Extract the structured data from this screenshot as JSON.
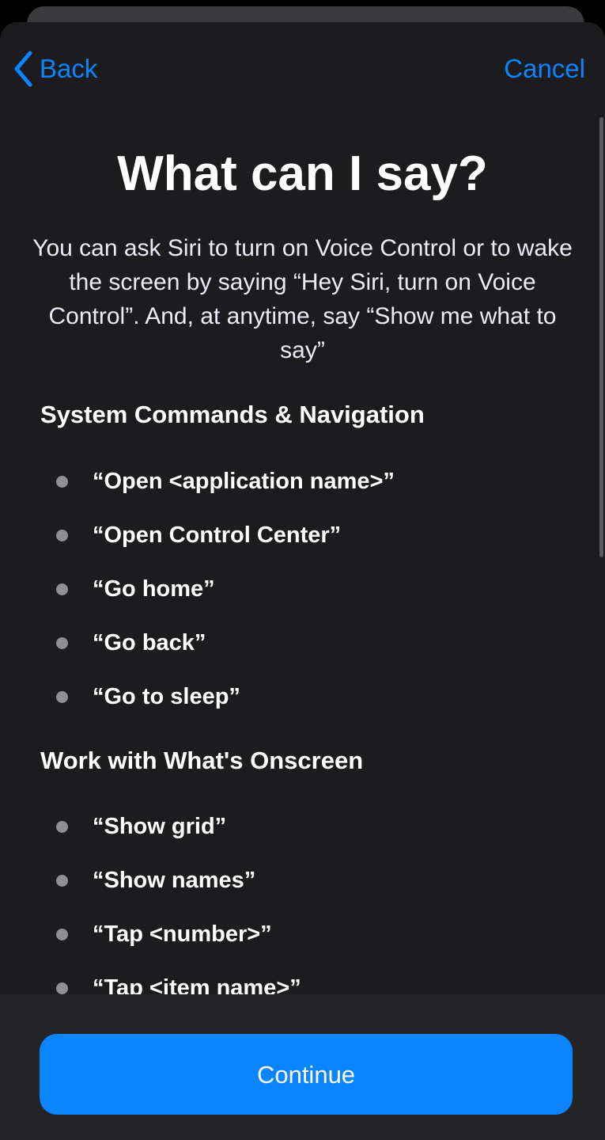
{
  "nav": {
    "back_label": "Back",
    "cancel_label": "Cancel"
  },
  "content": {
    "title": "What can I say?",
    "description": "You can ask Siri to turn on Voice Control or to wake the screen by saying “Hey Siri, turn on Voice Control”. And, at anytime, say “Show me what to say”",
    "sections": [
      {
        "title": "System Commands & Navigation",
        "items": [
          "“Open <application name>”",
          "“Open Control Center”",
          "“Go home”",
          "“Go back”",
          "“Go to sleep”"
        ]
      },
      {
        "title": "Work with What's Onscreen",
        "items": [
          "“Show grid”",
          "“Show names”",
          "“Tap <number>”",
          "“Tap <item name>”"
        ]
      }
    ]
  },
  "footer": {
    "continue_label": "Continue"
  },
  "colors": {
    "accent": "#0a84ff",
    "sheet_background": "#1c1c1e",
    "footer_background": "#242426",
    "bullet": "#8e8e93"
  },
  "icons": {
    "back": "chevron-left-icon"
  }
}
